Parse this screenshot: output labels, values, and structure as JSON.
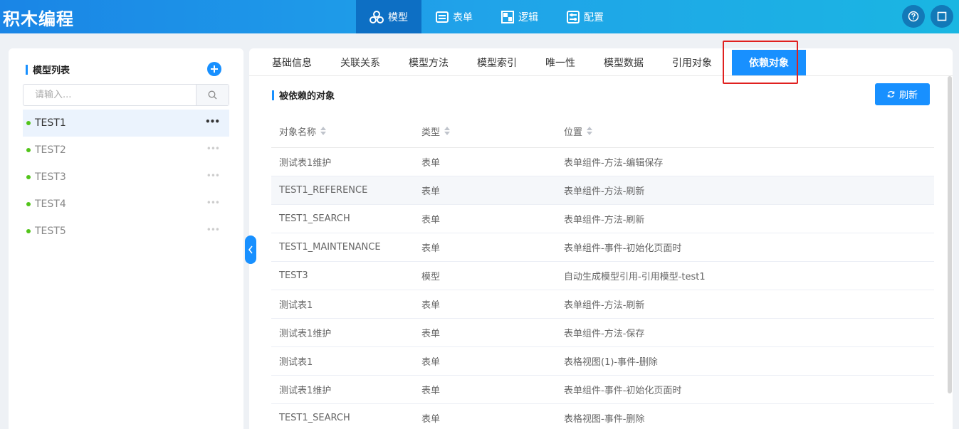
{
  "app": {
    "title": "积木编程"
  },
  "nav": [
    {
      "label": "模型",
      "icon": "model-icon",
      "active": true
    },
    {
      "label": "表单",
      "icon": "form-icon",
      "active": false
    },
    {
      "label": "逻辑",
      "icon": "logic-icon",
      "active": false
    },
    {
      "label": "配置",
      "icon": "config-icon",
      "active": false
    }
  ],
  "sidebar": {
    "title": "模型列表",
    "search_placeholder": "请输入...",
    "more_label": "•••",
    "items": [
      {
        "label": "TEST1",
        "selected": true
      },
      {
        "label": "TEST2",
        "selected": false
      },
      {
        "label": "TEST3",
        "selected": false
      },
      {
        "label": "TEST4",
        "selected": false
      },
      {
        "label": "TEST5",
        "selected": false
      }
    ]
  },
  "tabs": [
    {
      "label": "基础信息",
      "active": false
    },
    {
      "label": "关联关系",
      "active": false
    },
    {
      "label": "模型方法",
      "active": false
    },
    {
      "label": "模型索引",
      "active": false
    },
    {
      "label": "唯一性",
      "active": false
    },
    {
      "label": "模型数据",
      "active": false
    },
    {
      "label": "引用对象",
      "active": false
    },
    {
      "label": "依赖对象",
      "active": true
    }
  ],
  "section": {
    "title": "被依赖的对象",
    "refresh_label": "刷新"
  },
  "table": {
    "columns": [
      "对象名称",
      "类型",
      "位置"
    ],
    "rows": [
      [
        "测试表1维护",
        "表单",
        "表单组件-方法-编辑保存"
      ],
      [
        "TEST1_REFERENCE",
        "表单",
        "表单组件-方法-刷新"
      ],
      [
        "TEST1_SEARCH",
        "表单",
        "表单组件-方法-刷新"
      ],
      [
        "TEST1_MAINTENANCE",
        "表单",
        "表单组件-事件-初始化页面时"
      ],
      [
        "TEST3",
        "模型",
        "自动生成模型引用-引用模型-test1"
      ],
      [
        "测试表1",
        "表单",
        "表单组件-方法-刷新"
      ],
      [
        "测试表1维护",
        "表单",
        "表单组件-方法-保存"
      ],
      [
        "测试表1",
        "表单",
        "表格视图(1)-事件-删除"
      ],
      [
        "测试表1维护",
        "表单",
        "表单组件-事件-初始化页面时"
      ],
      [
        "TEST1_SEARCH",
        "表单",
        "表格视图-事件-删除"
      ]
    ]
  },
  "colors": {
    "accent": "#1890ff",
    "header_gradient_start": "#1a85e6",
    "header_gradient_end": "#1ab6e2",
    "highlight": "#e0201f",
    "status_dot": "#52c41a"
  }
}
